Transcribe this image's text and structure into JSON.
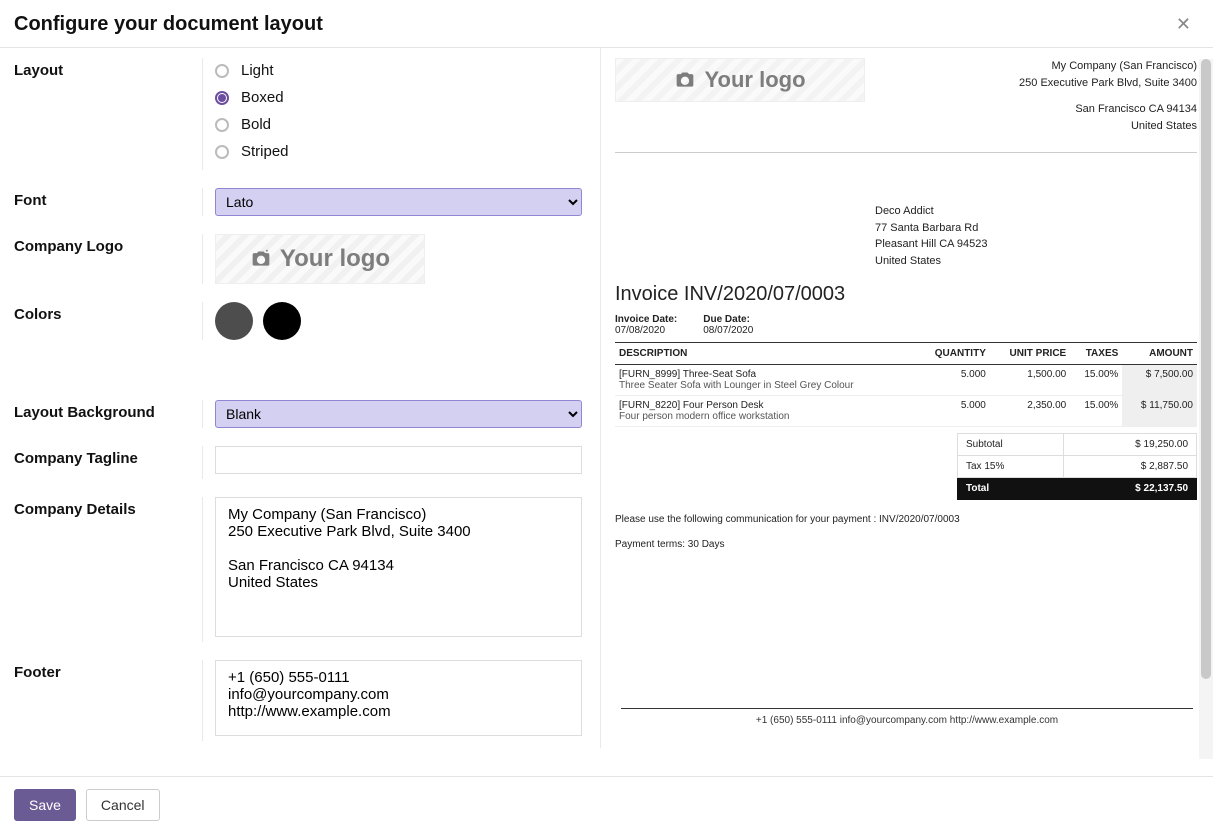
{
  "header": {
    "title": "Configure your document layout"
  },
  "labels": {
    "layout": "Layout",
    "font": "Font",
    "company_logo": "Company Logo",
    "colors": "Colors",
    "layout_bg": "Layout Background",
    "tagline": "Company Tagline",
    "details": "Company Details",
    "footer": "Footer"
  },
  "layout_options": {
    "light": "Light",
    "boxed": "Boxed",
    "bold": "Bold",
    "striped": "Striped"
  },
  "font_value": "Lato",
  "logo_placeholder": "Your logo",
  "colors": {
    "c1": "#4d4d4d",
    "c2": "#000000"
  },
  "bg_value": "Blank",
  "tagline_value": "",
  "details_value": "My Company (San Francisco)\n250 Executive Park Blvd, Suite 3400\n\nSan Francisco CA 94134\nUnited States",
  "footer_value": "+1 (650) 555-0111\ninfo@yourcompany.com\nhttp://www.example.com",
  "preview": {
    "company": {
      "l1": "My Company (San Francisco)",
      "l2": "250 Executive Park Blvd, Suite 3400",
      "l3": "San Francisco CA 94134",
      "l4": "United States"
    },
    "partner": {
      "l1": "Deco Addict",
      "l2": "77 Santa Barbara Rd",
      "l3": "Pleasant Hill CA 94523",
      "l4": "United States"
    },
    "inv_title": "Invoice INV/2020/07/0003",
    "inv_date_lbl": "Invoice Date:",
    "due_date_lbl": "Due Date:",
    "inv_date": "07/08/2020",
    "due_date": "08/07/2020",
    "cols": {
      "desc": "DESCRIPTION",
      "qty": "QUANTITY",
      "unitp": "UNIT PRICE",
      "taxes": "TAXES",
      "amount": "AMOUNT"
    },
    "rows": [
      {
        "desc1": "[FURN_8999] Three-Seat Sofa",
        "desc2": "Three Seater Sofa with Lounger in Steel Grey Colour",
        "qty": "5.000",
        "unitp": "1,500.00",
        "taxes": "15.00%",
        "amount": "$ 7,500.00"
      },
      {
        "desc1": "[FURN_8220] Four Person Desk",
        "desc2": "Four person modern office workstation",
        "qty": "5.000",
        "unitp": "2,350.00",
        "taxes": "15.00%",
        "amount": "$ 11,750.00"
      }
    ],
    "totals": {
      "sub_lbl": "Subtotal",
      "sub_val": "$ 19,250.00",
      "tax_lbl": "Tax 15%",
      "tax_val": "$ 2,887.50",
      "tot_lbl": "Total",
      "tot_val": "$ 22,137.50"
    },
    "comm_note": "Please use the following communication for your payment : INV/2020/07/0003",
    "terms_note": "Payment terms: 30 Days",
    "footer_line": "+1 (650) 555-0111 info@yourcompany.com http://www.example.com"
  },
  "buttons": {
    "save": "Save",
    "cancel": "Cancel"
  }
}
